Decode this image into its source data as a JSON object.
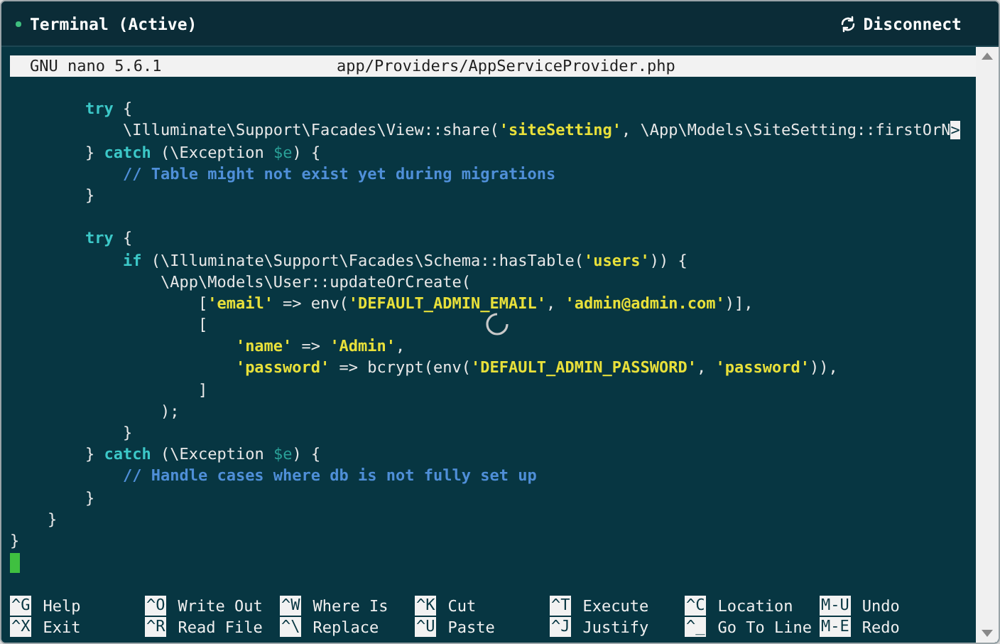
{
  "window": {
    "title": "Terminal (Active)",
    "disconnect_button": "Disconnect"
  },
  "nano_header": {
    "version": "GNU nano 5.6.1",
    "filename": "app/Providers/AppServiceProvider.php"
  },
  "code_lines": [
    {
      "kind": "blank"
    },
    {
      "kind": "code",
      "segments": [
        {
          "kind": "keyword",
          "text": "        try"
        },
        {
          "kind": "plain",
          "text": " {"
        }
      ]
    },
    {
      "kind": "code",
      "segments": [
        {
          "kind": "plain",
          "text": "            \\Illuminate\\Support\\Facades\\View::share("
        },
        {
          "kind": "string",
          "text": "'siteSetting'"
        },
        {
          "kind": "plain",
          "text": ", \\App\\Models\\SiteSetting::firstOrN"
        },
        {
          "kind": "overflow",
          "text": ">"
        }
      ]
    },
    {
      "kind": "code",
      "segments": [
        {
          "kind": "plain",
          "text": "        } "
        },
        {
          "kind": "keyword",
          "text": "catch"
        },
        {
          "kind": "plain",
          "text": " (\\Exception "
        },
        {
          "kind": "variable",
          "text": "$e"
        },
        {
          "kind": "plain",
          "text": ") {"
        }
      ]
    },
    {
      "kind": "code",
      "segments": [
        {
          "kind": "comment",
          "text": "            // Table might not exist yet during migrations"
        }
      ]
    },
    {
      "kind": "code",
      "segments": [
        {
          "kind": "plain",
          "text": "        }"
        }
      ]
    },
    {
      "kind": "blank"
    },
    {
      "kind": "code",
      "segments": [
        {
          "kind": "keyword",
          "text": "        try"
        },
        {
          "kind": "plain",
          "text": " {"
        }
      ]
    },
    {
      "kind": "code",
      "segments": [
        {
          "kind": "keyword",
          "text": "            if"
        },
        {
          "kind": "plain",
          "text": " (\\Illuminate\\Support\\Facades\\Schema::hasTable("
        },
        {
          "kind": "string",
          "text": "'users'"
        },
        {
          "kind": "plain",
          "text": ")) {"
        }
      ]
    },
    {
      "kind": "code",
      "segments": [
        {
          "kind": "plain",
          "text": "                \\App\\Models\\User::updateOrCreate("
        }
      ]
    },
    {
      "kind": "code",
      "segments": [
        {
          "kind": "plain",
          "text": "                    ["
        },
        {
          "kind": "string",
          "text": "'email'"
        },
        {
          "kind": "plain",
          "text": " => env("
        },
        {
          "kind": "string",
          "text": "'DEFAULT_ADMIN_EMAIL'"
        },
        {
          "kind": "plain",
          "text": ", "
        },
        {
          "kind": "string",
          "text": "'admin@admin.com'"
        },
        {
          "kind": "plain",
          "text": ")],"
        }
      ]
    },
    {
      "kind": "code",
      "segments": [
        {
          "kind": "plain",
          "text": "                    ["
        }
      ]
    },
    {
      "kind": "code",
      "segments": [
        {
          "kind": "string",
          "text": "                        'name'"
        },
        {
          "kind": "plain",
          "text": " => "
        },
        {
          "kind": "string",
          "text": "'Admin'"
        },
        {
          "kind": "plain",
          "text": ","
        }
      ]
    },
    {
      "kind": "code",
      "segments": [
        {
          "kind": "string",
          "text": "                        'password'"
        },
        {
          "kind": "plain",
          "text": " => bcrypt(env("
        },
        {
          "kind": "string",
          "text": "'DEFAULT_ADMIN_PASSWORD'"
        },
        {
          "kind": "plain",
          "text": ", "
        },
        {
          "kind": "string",
          "text": "'password'"
        },
        {
          "kind": "plain",
          "text": ")),"
        }
      ]
    },
    {
      "kind": "code",
      "segments": [
        {
          "kind": "plain",
          "text": "                    ]"
        }
      ]
    },
    {
      "kind": "code",
      "segments": [
        {
          "kind": "plain",
          "text": "                );"
        }
      ]
    },
    {
      "kind": "code",
      "segments": [
        {
          "kind": "plain",
          "text": "            }"
        }
      ]
    },
    {
      "kind": "code",
      "segments": [
        {
          "kind": "plain",
          "text": "        } "
        },
        {
          "kind": "keyword",
          "text": "catch"
        },
        {
          "kind": "plain",
          "text": " (\\Exception "
        },
        {
          "kind": "variable",
          "text": "$e"
        },
        {
          "kind": "plain",
          "text": ") {"
        }
      ]
    },
    {
      "kind": "code",
      "segments": [
        {
          "kind": "comment",
          "text": "            // Handle cases where db is not fully set up"
        }
      ]
    },
    {
      "kind": "code",
      "segments": [
        {
          "kind": "plain",
          "text": "        }"
        }
      ]
    },
    {
      "kind": "code",
      "segments": [
        {
          "kind": "plain",
          "text": "    }"
        }
      ]
    },
    {
      "kind": "code",
      "segments": [
        {
          "kind": "plain",
          "text": "}"
        }
      ]
    },
    {
      "kind": "cursor"
    }
  ],
  "shortcuts": [
    [
      {
        "key": "^G",
        "label": "Help"
      },
      {
        "key": "^O",
        "label": "Write Out"
      },
      {
        "key": "^W",
        "label": "Where Is"
      },
      {
        "key": "^K",
        "label": "Cut"
      },
      {
        "key": "^T",
        "label": "Execute"
      },
      {
        "key": "^C",
        "label": "Location"
      },
      {
        "key": "M-U",
        "label": "Undo"
      }
    ],
    [
      {
        "key": "^X",
        "label": "Exit"
      },
      {
        "key": "^R",
        "label": "Read File"
      },
      {
        "key": "^\\",
        "label": "Replace"
      },
      {
        "key": "^U",
        "label": "Paste"
      },
      {
        "key": "^J",
        "label": "Justify"
      },
      {
        "key": "^_",
        "label": "Go To Line"
      },
      {
        "key": "M-E",
        "label": "Redo"
      }
    ]
  ]
}
